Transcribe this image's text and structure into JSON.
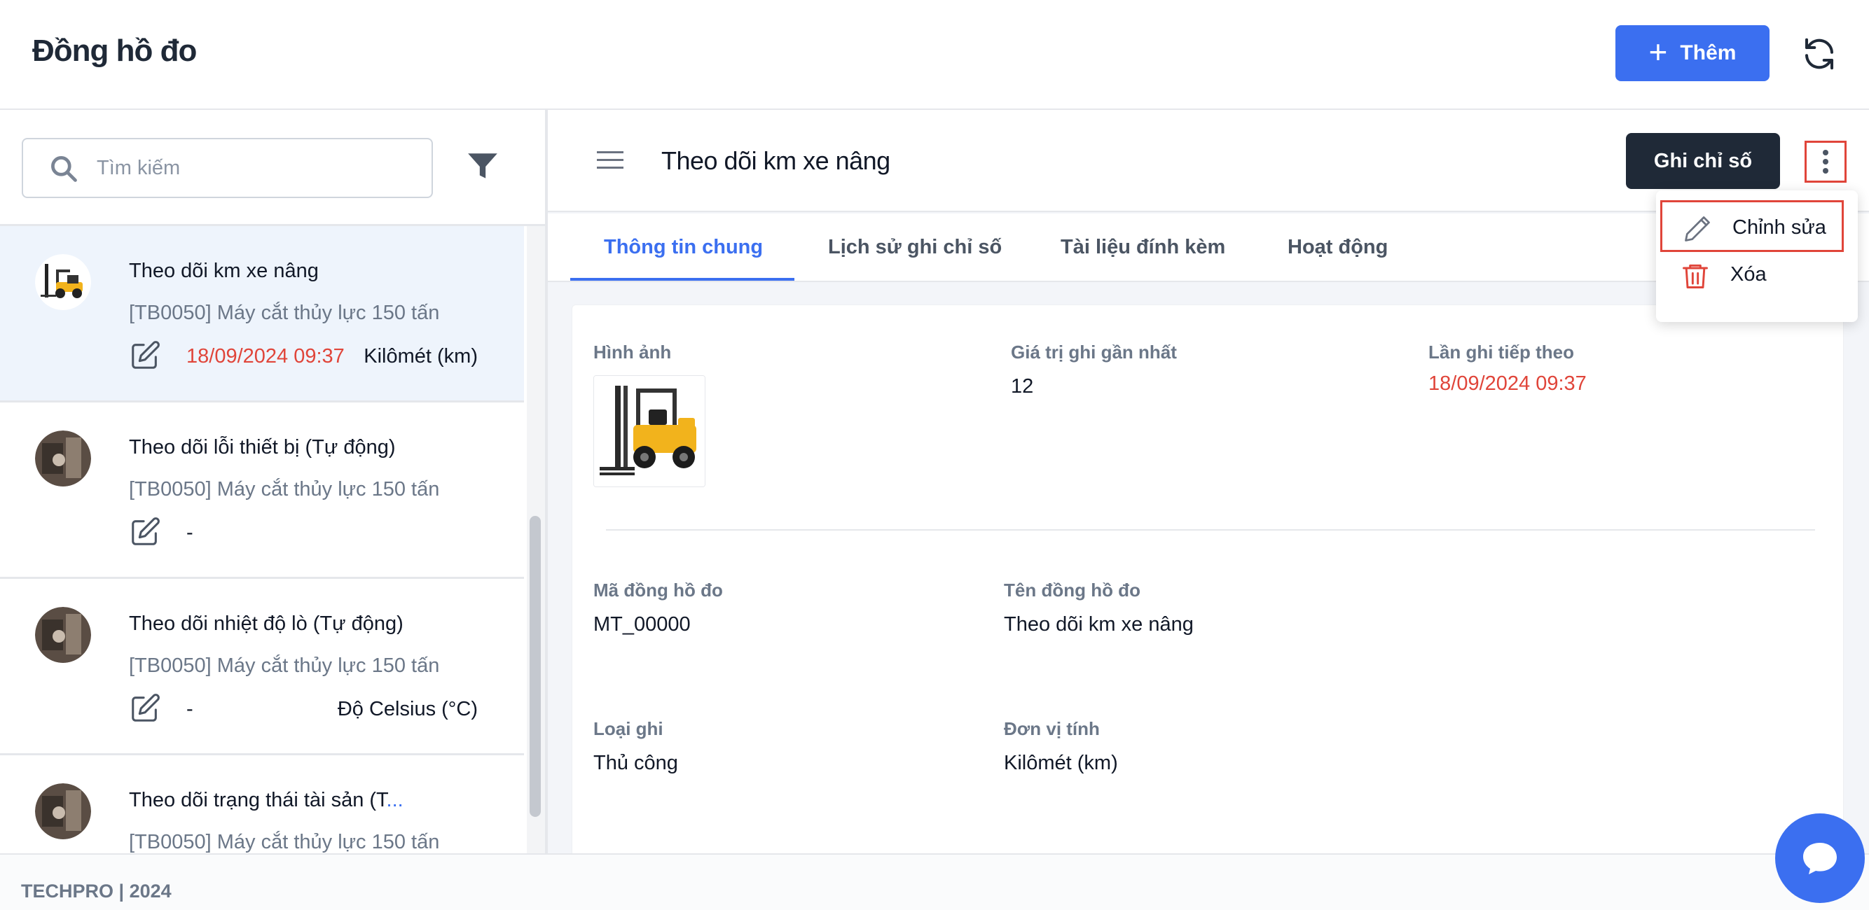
{
  "header": {
    "title": "Đồng hồ đo",
    "add_label": "Thêm",
    "accent": "#3b6ff0"
  },
  "search": {
    "placeholder": "Tìm kiếm"
  },
  "list": {
    "items": [
      {
        "title": "Theo dõi km xe nâng",
        "subtitle": "[TB0050] Máy cắt thủy lực 150 tấn",
        "date": "18/09/2024 09:37",
        "unit": "Kilômét (km)",
        "active": true
      },
      {
        "title": "Theo dõi lỗi thiết bị (Tự động)",
        "subtitle": "[TB0050] Máy cắt thủy lực 150 tấn",
        "date": "-",
        "unit": ""
      },
      {
        "title": "Theo dõi nhiệt độ lò (Tự động)",
        "subtitle": "[TB0050] Máy cắt thủy lực 150 tấn",
        "date": "-",
        "unit": "Độ Celsius (°C)"
      },
      {
        "title": "Theo dõi trạng thái tài sản (T",
        "title_ellipsis": "...",
        "subtitle": "[TB0050] Máy cắt thủy lực 150 tấn"
      }
    ]
  },
  "main": {
    "title": "Theo dõi km xe nâng",
    "record_label": "Ghi chỉ số",
    "tabs": [
      {
        "label": "Thông tin chung",
        "active": true
      },
      {
        "label": "Lịch sử ghi chỉ số"
      },
      {
        "label": "Tài liệu đính kèm"
      },
      {
        "label": "Hoạt động"
      }
    ],
    "fields": {
      "image_label": "Hình ảnh",
      "last_value_label": "Giá trị ghi gần nhất",
      "last_value": "12",
      "next_label": "Lần ghi tiếp theo",
      "next_value": "18/09/2024 09:37",
      "code_label": "Mã đồng hồ đo",
      "code_value": "MT_00000",
      "name_label": "Tên đồng hồ đo",
      "name_value": "Theo dõi km xe nâng",
      "type_label": "Loại ghi",
      "type_value": "Thủ công",
      "unit_label": "Đơn vị tính",
      "unit_value": "Kilômét (km)"
    }
  },
  "dropdown": {
    "edit_label": "Chỉnh sửa",
    "delete_label": "Xóa"
  },
  "footer": {
    "text": "TECHPRO | 2024"
  },
  "colors": {
    "danger": "#e0453a",
    "dark_button": "#1f2937",
    "active_row": "#eef4fc"
  }
}
